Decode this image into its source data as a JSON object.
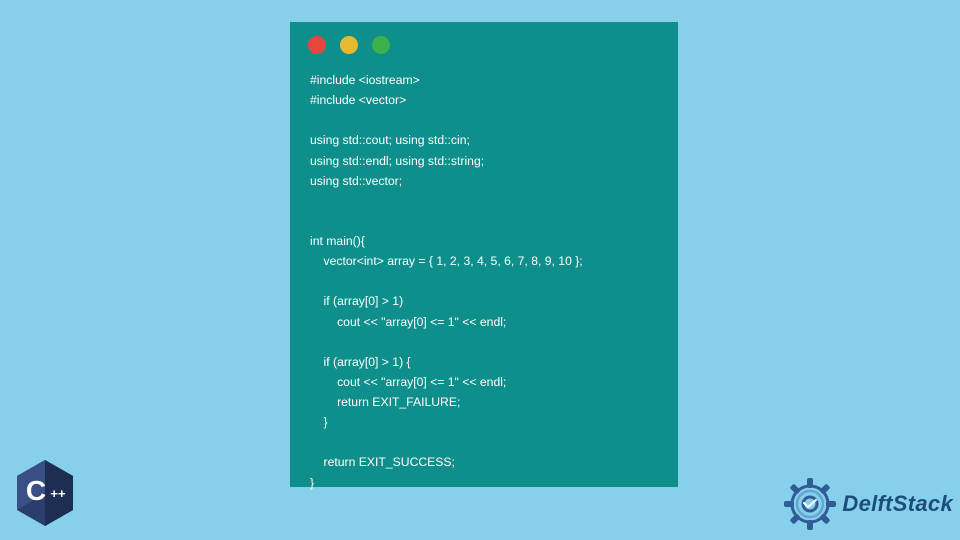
{
  "code": "#include <iostream>\n#include <vector>\n\nusing std::cout; using std::cin;\nusing std::endl; using std::string;\nusing std::vector;\n\n\nint main(){\n    vector<int> array = { 1, 2, 3, 4, 5, 6, 7, 8, 9, 10 };\n\n    if (array[0] > 1)\n        cout << \"array[0] <= 1\" << endl;\n\n    if (array[0] > 1) {\n        cout << \"array[0] <= 1\" << endl;\n        return EXIT_FAILURE;\n    }\n\n    return EXIT_SUCCESS;\n}",
  "brand": "DelftStack",
  "cpp_label": "C",
  "cpp_plus": "++"
}
